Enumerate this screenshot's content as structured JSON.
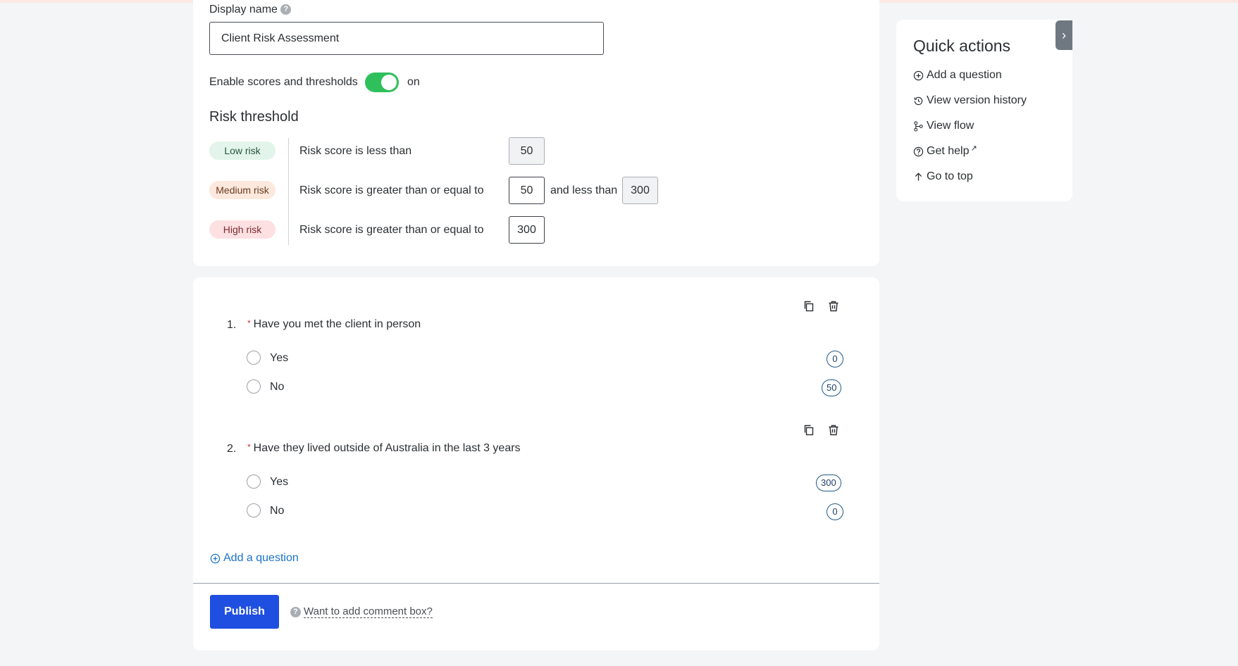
{
  "form": {
    "display_name_label": "Display name",
    "display_name_value": "Client Risk Assessment",
    "toggle_label": "Enable scores and thresholds",
    "toggle_state": "on",
    "risk_threshold_title": "Risk threshold",
    "thresholds": [
      {
        "badge": "Low risk",
        "rule": "Risk score is less than",
        "value": "50"
      },
      {
        "badge": "Medium risk",
        "rule": "Risk score is greater than or equal to",
        "value": "50",
        "and_text": "and less than",
        "value2": "300"
      },
      {
        "badge": "High risk",
        "rule": "Risk score is greater than or equal to",
        "value": "300"
      }
    ]
  },
  "questions": [
    {
      "number": "1.",
      "required_mark": "*",
      "text": "Have you met the client in person",
      "options": [
        {
          "label": "Yes",
          "score": "0"
        },
        {
          "label": "No",
          "score": "50"
        }
      ]
    },
    {
      "number": "2.",
      "required_mark": "*",
      "text": "Have they lived outside of Australia in the last 3 years",
      "options": [
        {
          "label": "Yes",
          "score": "300"
        },
        {
          "label": "No",
          "score": "0"
        }
      ]
    }
  ],
  "add_question_label": "Add a question",
  "footer": {
    "publish_label": "Publish",
    "comment_link": "Want to add comment box?"
  },
  "quick_actions": {
    "title": "Quick actions",
    "items": [
      {
        "label": "Add a question",
        "icon": "plus-circle-icon"
      },
      {
        "label": "View version history",
        "icon": "history-icon"
      },
      {
        "label": "View flow",
        "icon": "flow-icon"
      },
      {
        "label": "Get help",
        "icon": "help-circle-icon"
      },
      {
        "label": "Go to top",
        "icon": "arrow-up-icon"
      }
    ]
  },
  "colors": {
    "accent": "#1f4fe0",
    "toggle_on": "#2fbf5b",
    "link": "#1a73c8"
  }
}
